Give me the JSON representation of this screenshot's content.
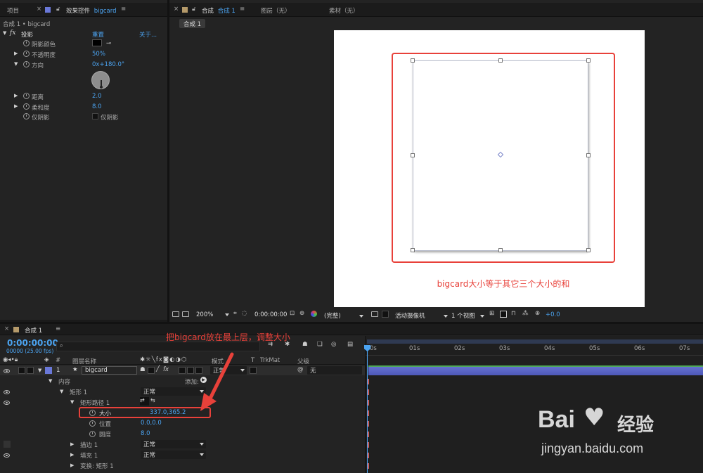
{
  "top_tabs": {
    "project": "项目",
    "effects_label": "效果控件",
    "effects_layer": "bigcard",
    "comp_close": "×",
    "comp_label": "合成",
    "comp_name": "合成 1",
    "layer_tab": "图层（无）",
    "footage_tab": "素材（无）",
    "menu_glyph": "≡"
  },
  "effects": {
    "breadcrumb": "合成 1 • bigcard",
    "effect_name": "投影",
    "reset": "重置",
    "about": "关于...",
    "props": [
      {
        "label": "阴影颜色",
        "value": ""
      },
      {
        "label": "不透明度",
        "value": "50%"
      },
      {
        "label": "方向",
        "value": "0x+180.0°"
      },
      {
        "label": "距离",
        "value": "2.0"
      },
      {
        "label": "柔和度",
        "value": "8.0"
      },
      {
        "label": "仅阴影",
        "value": "仅阴影"
      }
    ]
  },
  "viewer": {
    "comp_tab": "合成 1",
    "annotation": "bigcard大小等于其它三个大小的和",
    "zoom": "200%",
    "timecode": "0:00:00:00",
    "quality": "(完整)",
    "camera": "活动摄像机",
    "views": "1 个视图",
    "exposure": "+0.0"
  },
  "timeline": {
    "tab": "合成 1",
    "timecode": "0:00:00:00",
    "fps": "00000 (25.00 fps)",
    "search_placeholder": "",
    "annotation": "把bigcard放在最上层，调整大小",
    "col_hash": "#",
    "col_name": "图层名称",
    "col_mode": "模式",
    "col_t": "T",
    "col_trkmat": "TrkMat",
    "col_parent": "父级",
    "ruler": [
      "0s",
      "01s",
      "02s",
      "03s",
      "04s",
      "05s",
      "06s",
      "07s"
    ],
    "layer": {
      "num": "1",
      "name": "bigcard",
      "mode": "正常",
      "parent": "无"
    },
    "contents": "内容",
    "add_label": "添加:",
    "rect1": "矩形 1",
    "rect1_mode": "正常",
    "path": "矩形路径 1",
    "size_label": "大小",
    "size_value": "337.0,365.2",
    "pos_label": "位置",
    "pos_value": "0.0,0.0",
    "round_label": "圆度",
    "round_value": "8.0",
    "stroke": "描边 1",
    "stroke_mode": "正常",
    "fill": "填充 1",
    "fill_mode": "正常",
    "transform": "变换: 矩形 1"
  },
  "watermark": {
    "brand_left": "Bai",
    "brand_right": "经验",
    "url": "jingyan.baidu.com"
  },
  "colors": {
    "accent": "#4ba3f0",
    "annotation": "#e8413a",
    "layer_label": "#6a78d8"
  }
}
